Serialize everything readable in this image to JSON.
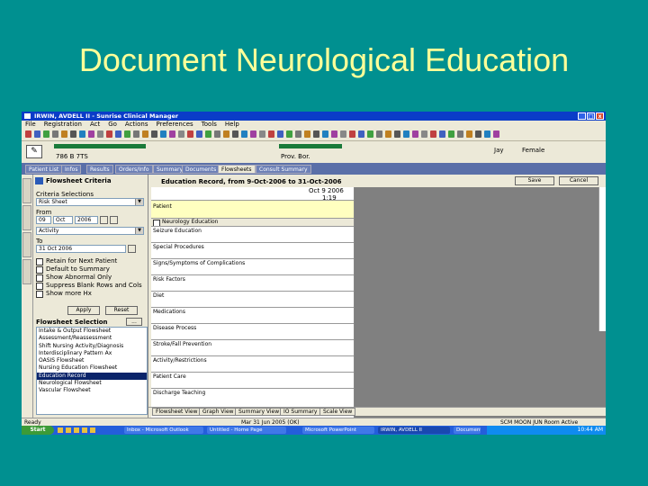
{
  "slide": {
    "title": "Document Neurological Education"
  },
  "window": {
    "title": "IRWIN, AVDELL II - Sunrise Clinical Manager",
    "controls": {
      "minimize": "_",
      "maximize": "□",
      "close": "x"
    }
  },
  "menu": [
    "File",
    "Registration",
    "Act",
    "Go",
    "Actions",
    "Preferences",
    "Tools",
    "Help"
  ],
  "patient": {
    "id_partial": "786 B 7TS",
    "location_partial": "Prov. Bor.",
    "age_partial": "Jay",
    "sex": "Female"
  },
  "tabs": [
    "Patient List",
    "Infos",
    "Results",
    "Orders/Info",
    "Summary",
    "Documents",
    "Flowsheets",
    "Consult Summary"
  ],
  "active_tab_index": 6,
  "left_panel": {
    "header": "Flowsheet Criteria",
    "select_label": "Criteria Selections",
    "select_value": "Risk Sheet",
    "from_label": "From",
    "from_day": "09",
    "from_month": "Oct",
    "from_year": "2006",
    "from_time_value": "Activity",
    "to_label": "To",
    "to_date_value": "31  Oct  2006",
    "options": [
      "Retain for Next Patient",
      "Default to Summary",
      "Show Abnormal Only",
      "Suppress Blank Rows and Cols",
      "Show more Hx"
    ],
    "apply_label": "Apply",
    "reset_label": "Reset",
    "list_header": "Flowsheet Selection",
    "list_items": [
      "Intake & Output Flowsheet",
      "Assessment/Reassessment",
      "Shift Nursing Activity/Diagnosis",
      "Interdisciplinary Pattern Ax",
      "OASIS Flowsheet",
      "Nursing Education Flowsheet",
      "Education Record",
      "Neurological Flowsheet",
      "Vascular Flowsheet"
    ],
    "selected_index": 6
  },
  "document": {
    "header": "Education Record, from 9-Oct-2006 to 31-Oct-2006",
    "save_label": "Save",
    "cancel_label": "Cancel",
    "col_date": "Oct 9 2006",
    "col_time": "1:19",
    "rows": [
      "Patient",
      "Neurology Education",
      "Seizure Education",
      "Special Procedures",
      "Signs/Symptoms of Complications",
      "Risk Factors",
      "Diet",
      "Medications",
      "Disease Process",
      "Stroke/Fall Prevention",
      "Activity/Restrictions",
      "Patient Care",
      "Discharge Teaching"
    ],
    "bottom_tabs": [
      "Flowsheet View",
      "Graph View",
      "Summary View",
      "IO Summary",
      "Scale View"
    ]
  },
  "status": {
    "left": "Ready",
    "middle": "Mar 31 Jun 2005 (OK)",
    "right": "SCM  MOON  JUN   Room Active"
  },
  "taskbar": {
    "start_label": "Start",
    "tasks": [
      "Inbox - Microsoft Outlook",
      "Untitled - Home Page",
      "Microsoft PowerPoint",
      "IRWIN, AVDELL II",
      "Document..."
    ],
    "clock": "10:44 AM"
  },
  "colors": {
    "background": "#009090",
    "title": "#ffff99",
    "selection": "#0a246a",
    "titlebar": "#0a3cc8"
  }
}
